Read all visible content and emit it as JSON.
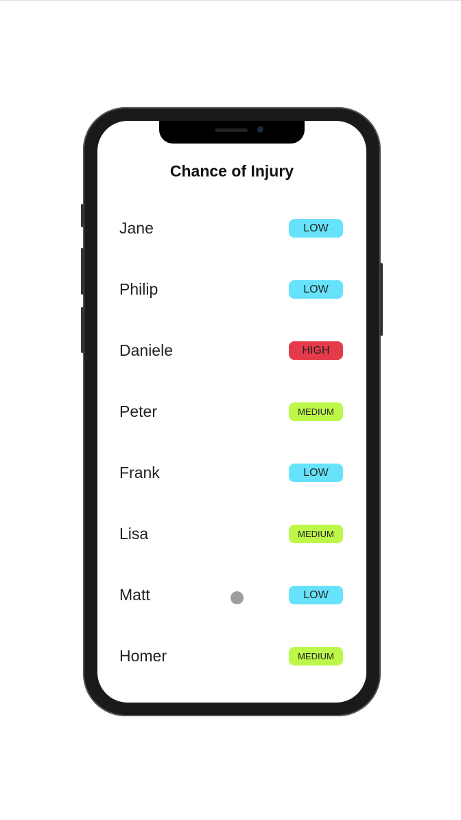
{
  "title": "Chance of Injury",
  "levels": {
    "LOW": {
      "label": "LOW",
      "color": "#66e3fa"
    },
    "HIGH": {
      "label": "HIGH",
      "color": "#e53a4a"
    },
    "MEDIUM": {
      "label": "MEDIUM",
      "color": "#bdf74a"
    }
  },
  "players": [
    {
      "name": "Jane",
      "risk": "LOW"
    },
    {
      "name": "Philip",
      "risk": "LOW"
    },
    {
      "name": "Daniele",
      "risk": "HIGH"
    },
    {
      "name": "Peter",
      "risk": "MEDIUM"
    },
    {
      "name": "Frank",
      "risk": "LOW"
    },
    {
      "name": "Lisa",
      "risk": "MEDIUM"
    },
    {
      "name": "Matt",
      "risk": "LOW"
    },
    {
      "name": "Homer",
      "risk": "MEDIUM"
    }
  ]
}
